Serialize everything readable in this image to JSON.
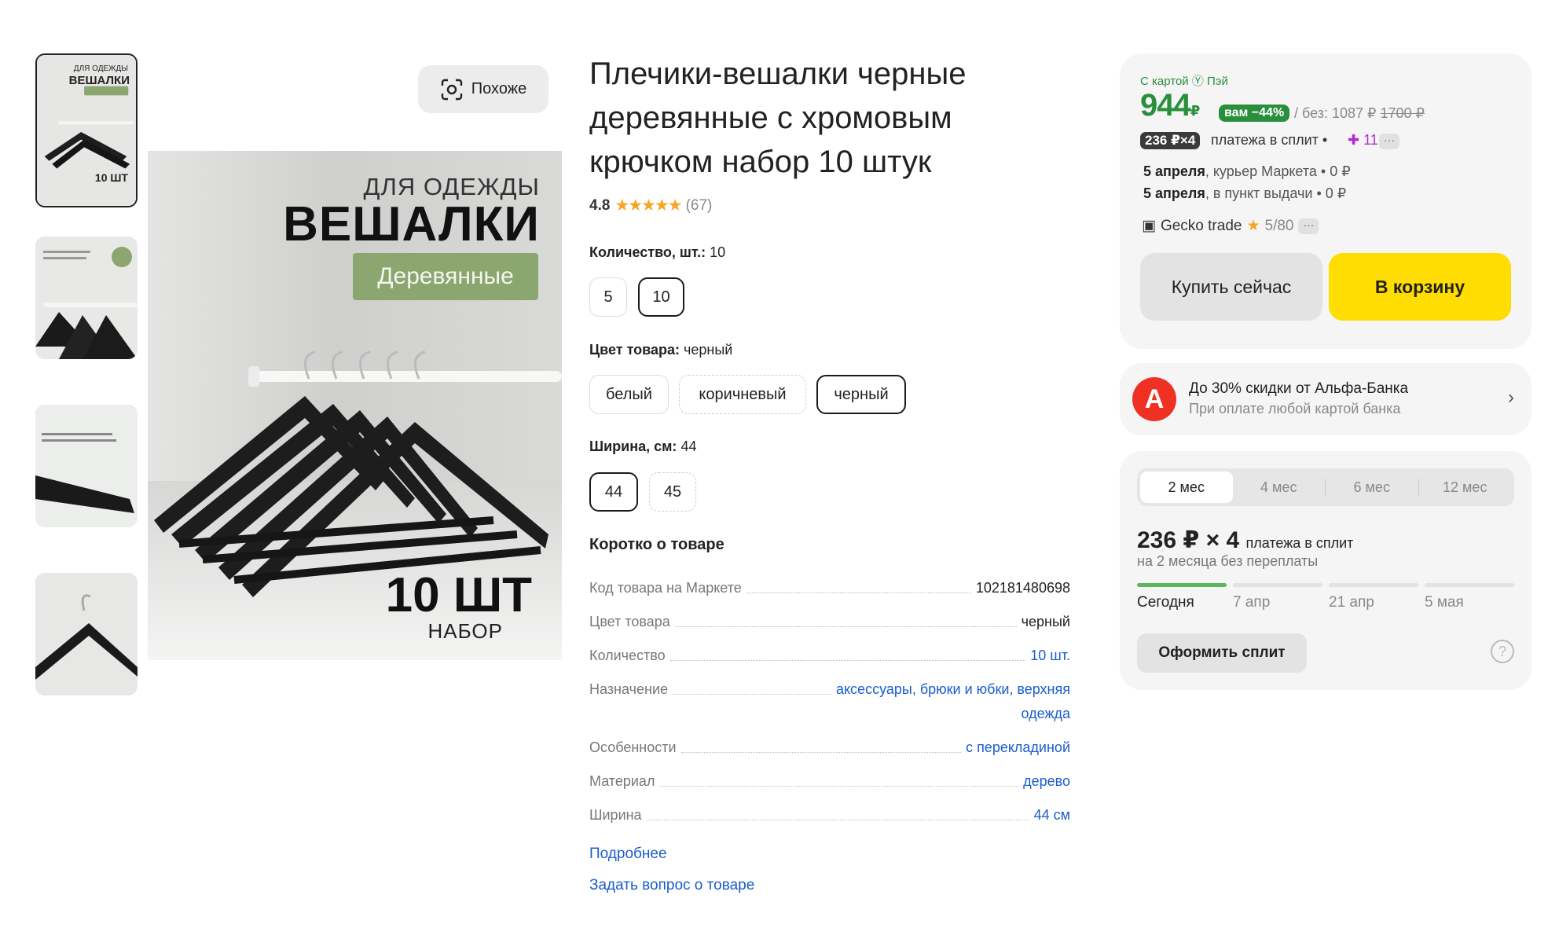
{
  "gallery": {
    "similar_label": "Похоже",
    "thumb1_line1": "ДЛЯ ОДЕЖДЫ",
    "thumb1_line2": "ВЕШАЛКИ",
    "thumb1_line3": "10 ШТ",
    "main_line1": "ДЛЯ ОДЕЖДЫ",
    "main_line2": "ВЕШАЛКИ",
    "main_badge": "Деревянные",
    "main_line3": "10 ШТ",
    "main_line4": "НАБОР"
  },
  "product": {
    "title": "Плечики-вешалки черные деревянные с хромовым крючком набор 10 штук",
    "rating": "4.8",
    "stars": "★★★★★",
    "reviews": "(67)"
  },
  "options": {
    "quantity": {
      "label": "Количество, шт.:",
      "value": "10",
      "choices": [
        "5",
        "10"
      ]
    },
    "color": {
      "label": "Цвет товара:",
      "value": "черный",
      "choices": [
        "белый",
        "коричневый",
        "черный"
      ]
    },
    "width": {
      "label": "Ширина, см:",
      "value": "44",
      "choices": [
        "44",
        "45"
      ]
    }
  },
  "brief": {
    "title": "Коротко о товаре",
    "rows": [
      {
        "key": "Код товара на Маркете",
        "value": "102181480698"
      },
      {
        "key": "Цвет товара",
        "value": "черный"
      },
      {
        "key": "Количество",
        "value": "10 шт."
      },
      {
        "key": "Назначение",
        "value_line1": "аксессуары, брюки и юбки, верхняя",
        "value_line2": "одежда"
      },
      {
        "key": "Особенности",
        "value": "с перекладиной"
      },
      {
        "key": "Материал",
        "value": "дерево"
      },
      {
        "key": "Ширина",
        "value": "44 см"
      }
    ],
    "more_link": "Подробнее",
    "ask_link": "Задать вопрос о товаре"
  },
  "price_card": {
    "card_label": "С картой Ⓨ Пэй",
    "price": "944",
    "currency": "₽",
    "discount_badge": "вам −44%",
    "old_prefix": "/ без: 1087 ₽",
    "old_price": "1700 ₽",
    "split_badge": "236 ₽×4",
    "split_text": "платежа в сплит •",
    "plus_points": "11",
    "delivery1_date": "5 апреля",
    "delivery1_rest": ", курьер Маркета • 0 ₽",
    "delivery2_date": "5 апреля",
    "delivery2_rest": ", в пункт выдачи • 0 ₽",
    "seller_name": "Gecko trade",
    "seller_rating": "5/80",
    "buy_now": "Купить сейчас",
    "add_to_cart": "В корзину"
  },
  "alfa": {
    "logo": "А",
    "line1": "До 30% скидки от Альфа-Банка",
    "line2": "При оплате любой картой банка"
  },
  "split": {
    "tabs": [
      "2 мес",
      "4 мес",
      "6 мес",
      "12 мес"
    ],
    "amount": "236 ₽ × 4",
    "amount_suffix": "платежа в сплит",
    "sub": "на 2 месяца без переплаты",
    "dates": [
      "Сегодня",
      "7 апр",
      "21 апр",
      "5 мая"
    ],
    "button": "Оформить сплит"
  },
  "colors": {
    "accent_yellow": "#ffdd00",
    "price_green": "#2a8f3c",
    "link_blue": "#1a5dcc",
    "alfa_red": "#ef3124"
  }
}
